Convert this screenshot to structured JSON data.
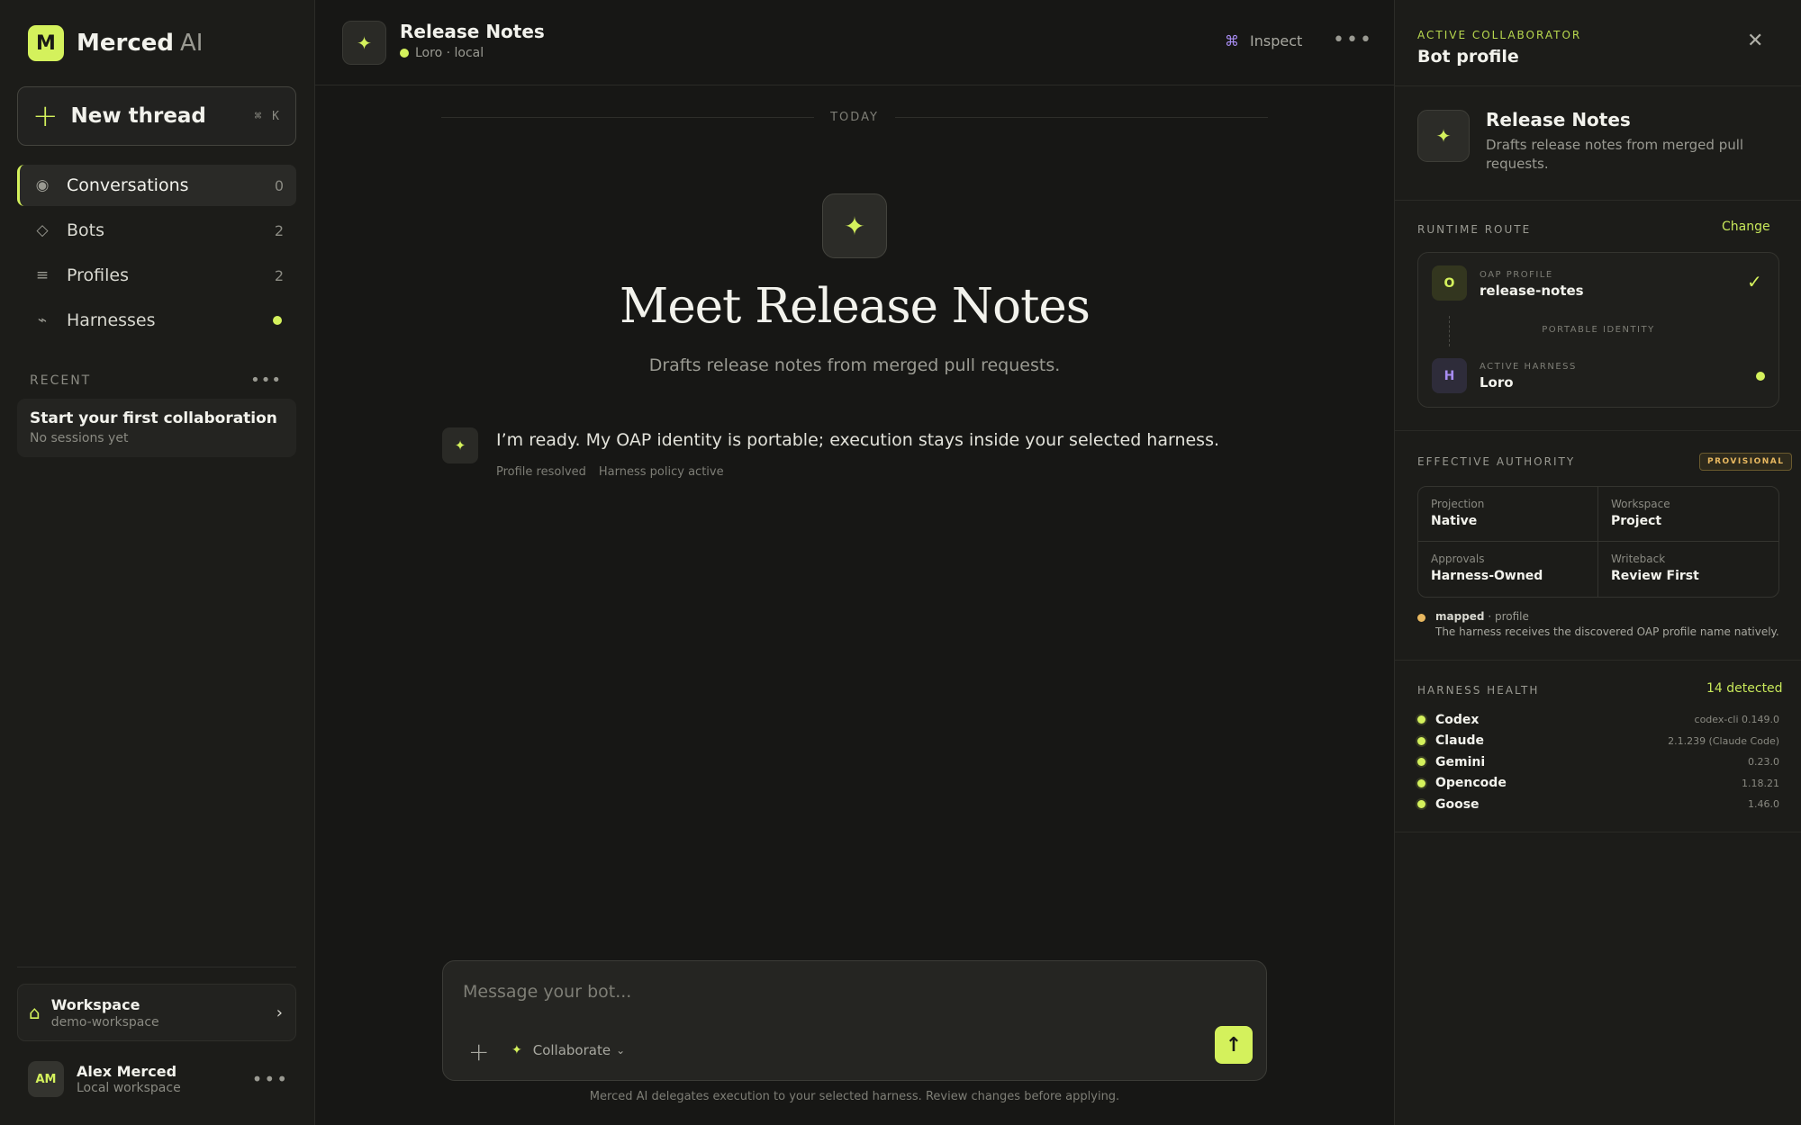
{
  "sidebar": {
    "brand": {
      "logo_letter": "M",
      "name": "Merced",
      "suffix": "AI"
    },
    "new_thread": {
      "label": "New thread",
      "shortcut": "⌘ K"
    },
    "nav": [
      {
        "label": "Conversations",
        "count": "0",
        "icon": "radio-icon",
        "active": true
      },
      {
        "label": "Bots",
        "count": "2",
        "icon": "diamond-icon"
      },
      {
        "label": "Profiles",
        "count": "2",
        "icon": "list-icon"
      },
      {
        "label": "Harnesses",
        "icon": "plug-icon",
        "status": "active"
      }
    ],
    "recent": {
      "heading": "RECENT",
      "card_title": "Start your first collaboration",
      "card_sub": "No sessions yet"
    },
    "workspace": {
      "title": "Workspace",
      "name": "demo-workspace"
    },
    "user": {
      "initials": "AM",
      "name": "Alex Merced",
      "sub": "Local workspace"
    }
  },
  "header": {
    "title": "Release Notes",
    "status": "Loro · local",
    "inspect_label": "Inspect"
  },
  "chat": {
    "date_divider": "TODAY",
    "hero_title": "Meet Release Notes",
    "hero_sub": "Drafts release notes from merged pull requests.",
    "message": {
      "text": "I’m ready. My OAP identity is portable; execution stays inside your selected harness.",
      "meta": [
        "Profile resolved",
        "Harness policy active"
      ]
    },
    "composer": {
      "placeholder": "Message your bot...",
      "mode": "Collaborate"
    },
    "disclaimer": "Merced AI delegates execution to your selected harness. Review changes before applying."
  },
  "panel": {
    "eyebrow": "ACTIVE COLLABORATOR",
    "title": "Bot profile",
    "bot": {
      "name": "Release Notes",
      "desc": "Drafts release notes from merged pull requests."
    },
    "runtime": {
      "label": "RUNTIME ROUTE",
      "change": "Change",
      "oap_badge": "O",
      "oap_label": "OAP PROFILE",
      "oap_value": "release-notes",
      "portable": "PORTABLE IDENTITY",
      "harness_badge": "H",
      "harness_label": "ACTIVE HARNESS",
      "harness_value": "Loro"
    },
    "authority": {
      "label": "EFFECTIVE AUTHORITY",
      "badge": "PROVISIONAL",
      "cells": [
        {
          "k": "Projection",
          "v": "Native"
        },
        {
          "k": "Workspace",
          "v": "Project"
        },
        {
          "k": "Approvals",
          "v": "Harness-Owned"
        },
        {
          "k": "Writeback",
          "v": "Review First"
        }
      ],
      "mapped_strong": "mapped",
      "mapped_rest": " · profile",
      "mapped_note": "The harness receives the discovered OAP profile name natively."
    },
    "health": {
      "label": "HARNESS HEALTH",
      "detected": "14 detected",
      "items": [
        {
          "name": "Codex",
          "version": "codex-cli 0.149.0"
        },
        {
          "name": "Claude",
          "version": "2.1.239 (Claude Code)"
        },
        {
          "name": "Gemini",
          "version": "0.23.0"
        },
        {
          "name": "Opencode",
          "version": "1.18.21"
        },
        {
          "name": "Goose",
          "version": "1.46.0"
        }
      ]
    }
  },
  "colors": {
    "accent": "#d4f15c",
    "background": "#171715",
    "panel": "#1c1c19",
    "warning": "#e8b860",
    "harness": "#a88df2"
  }
}
